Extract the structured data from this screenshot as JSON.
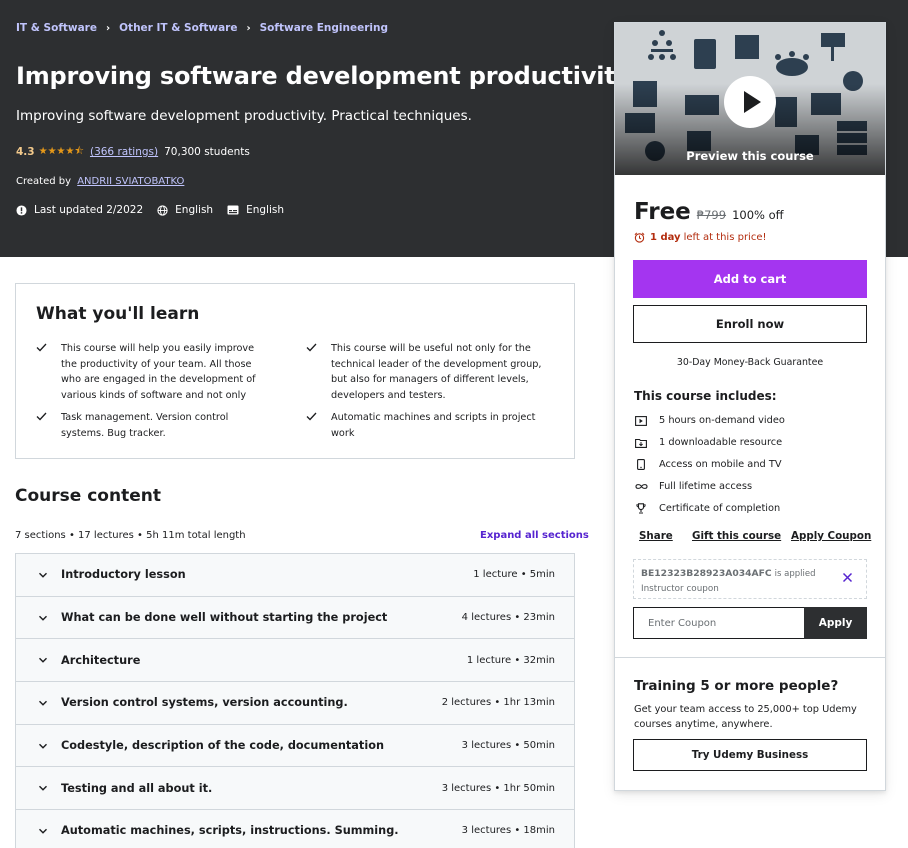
{
  "breadcrumbs": [
    "IT & Software",
    "Other IT & Software",
    "Software Engineering"
  ],
  "course": {
    "title": "Improving software development productivity",
    "subtitle": "Improving software development productivity. Practical techniques.",
    "rating": "4.3",
    "ratings_count": "(366 ratings)",
    "students": "70,300 students",
    "created_by_label": "Created by",
    "author": "ANDRII SVIATOBATKO",
    "last_updated": "Last updated 2/2022",
    "language": "English",
    "captions": "English"
  },
  "learn": {
    "title": "What you'll learn",
    "items": [
      "This course will help you easily improve the productivity of your team. All those who are engaged in the development of various kinds of software and not only",
      "This course will be useful not only for the technical leader of the development group, but also for managers of different levels, developers and testers.",
      "Task management. Version control systems. Bug tracker.",
      "Automatic machines and scripts in project work"
    ]
  },
  "content": {
    "title": "Course content",
    "stats": "7 sections • 17 lectures • 5h 11m total length",
    "expand_label": "Expand all sections",
    "sections": [
      {
        "title": "Introductory lesson",
        "info": "1 lecture • 5min"
      },
      {
        "title": "What can be done well without starting the project",
        "info": "4 lectures • 23min"
      },
      {
        "title": "Architecture",
        "info": "1 lecture • 32min"
      },
      {
        "title": "Version control systems, version accounting.",
        "info": "2 lectures • 1hr 13min"
      },
      {
        "title": "Codestyle, description of the code, documentation",
        "info": "3 lectures • 50min"
      },
      {
        "title": "Testing and all about it.",
        "info": "3 lectures • 1hr 50min"
      },
      {
        "title": "Automatic machines, scripts, instructions. Summing.",
        "info": "3 lectures • 18min"
      }
    ]
  },
  "sidebar": {
    "preview_label": "Preview this course",
    "price": "Free",
    "original_price": "₱799",
    "discount": "100% off",
    "deadline_bold": "1 day",
    "deadline_rest": "left at this price!",
    "add_to_cart": "Add to cart",
    "enroll_now": "Enroll now",
    "guarantee": "30-Day Money-Back Guarantee",
    "includes_title": "This course includes:",
    "includes": [
      "5 hours on-demand video",
      "1 downloadable resource",
      "Access on mobile and TV",
      "Full lifetime access",
      "Certificate of completion"
    ],
    "share": "Share",
    "gift": "Gift this course",
    "apply_coupon": "Apply Coupon",
    "coupon_code": "BE12323B28923A034AFC",
    "coupon_applied": "is applied",
    "coupon_type": "Instructor coupon",
    "coupon_placeholder": "Enter Coupon",
    "apply": "Apply",
    "business_title": "Training 5 or more people?",
    "business_text": "Get your team access to 25,000+ top Udemy courses anytime, anywhere.",
    "business_button": "Try Udemy Business"
  },
  "colors": {
    "header_bg": "#2d2f31",
    "link_light": "#c0c4fc",
    "rating_gold": "#f3ca8c",
    "star": "#e59819",
    "accent_purple": "#a435f0",
    "expand_purple": "#5624d0",
    "deadline_red": "#b32d0f"
  }
}
